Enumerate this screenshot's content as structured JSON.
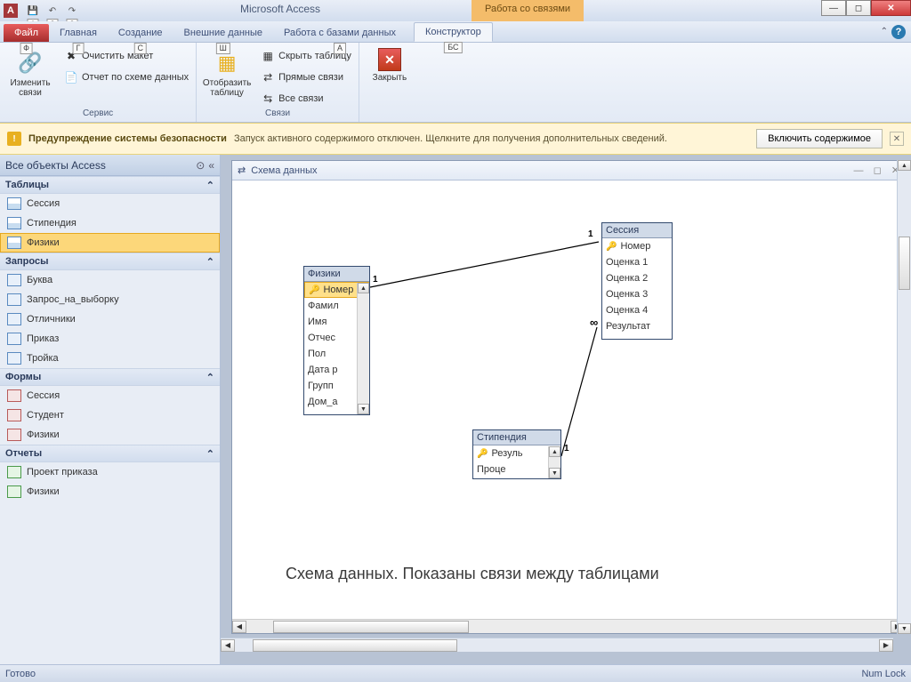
{
  "title": {
    "app": "Microsoft Access",
    "context": "Работа со связями"
  },
  "tabs": {
    "file": "Файл",
    "home": "Главная",
    "create": "Создание",
    "external": "Внешние данные",
    "database": "Работа с базами данных",
    "design": "Конструктор",
    "tip_file": "Ф",
    "tip_home": "Г",
    "tip_create": "С",
    "tip_external": "Ш",
    "tip_database": "А",
    "tip_design": "БС",
    "tip_qat1": "1",
    "tip_qat2": "2",
    "tip_qat3": "3"
  },
  "ribbon": {
    "edit_rel": "Изменить\nсвязи",
    "clear_layout": "Очистить макет",
    "report_schema": "Отчет по схеме данных",
    "group_service": "Сервис",
    "show_table": "Отобразить\nтаблицу",
    "hide_table": "Скрыть таблицу",
    "direct_rel": "Прямые связи",
    "all_rel": "Все связи",
    "group_rel": "Связи",
    "close": "Закрыть"
  },
  "security": {
    "title": "Предупреждение системы безопасности",
    "msg": "Запуск активного содержимого отключен. Щелкните для получения дополнительных сведений.",
    "btn": "Включить содержимое"
  },
  "nav": {
    "header": "Все объекты Access",
    "g_tables": "Таблицы",
    "tables": [
      "Сессия",
      "Стипендия",
      "Физики"
    ],
    "g_queries": "Запросы",
    "queries": [
      "Буква",
      "Запрос_на_выборку",
      "Отличники",
      "Приказ",
      "Тройка"
    ],
    "g_forms": "Формы",
    "forms": [
      "Сессия",
      "Студент",
      "Физики"
    ],
    "g_reports": "Отчеты",
    "reports": [
      "Проект приказа",
      "Физики"
    ]
  },
  "doc": {
    "title": "Схема данных",
    "caption": "Схема данных. Показаны связи между таблицами",
    "table_fiziki": {
      "title": "Физики",
      "fields": [
        "Номер",
        "Фамил",
        "Имя",
        "Отчес",
        "Пол",
        "Дата р",
        "Групп",
        "Дом_а"
      ]
    },
    "table_session": {
      "title": "Сессия",
      "fields": [
        "Номер",
        "Оценка 1",
        "Оценка 2",
        "Оценка 3",
        "Оценка 4",
        "Результат"
      ]
    },
    "table_stipend": {
      "title": "Стипендия",
      "fields": [
        "Резуль",
        "Проце"
      ]
    },
    "rel": {
      "one_a": "1",
      "one_b": "1",
      "one_c": "1",
      "inf": "∞"
    }
  },
  "status": {
    "ready": "Готово",
    "numlock": "Num Lock"
  }
}
